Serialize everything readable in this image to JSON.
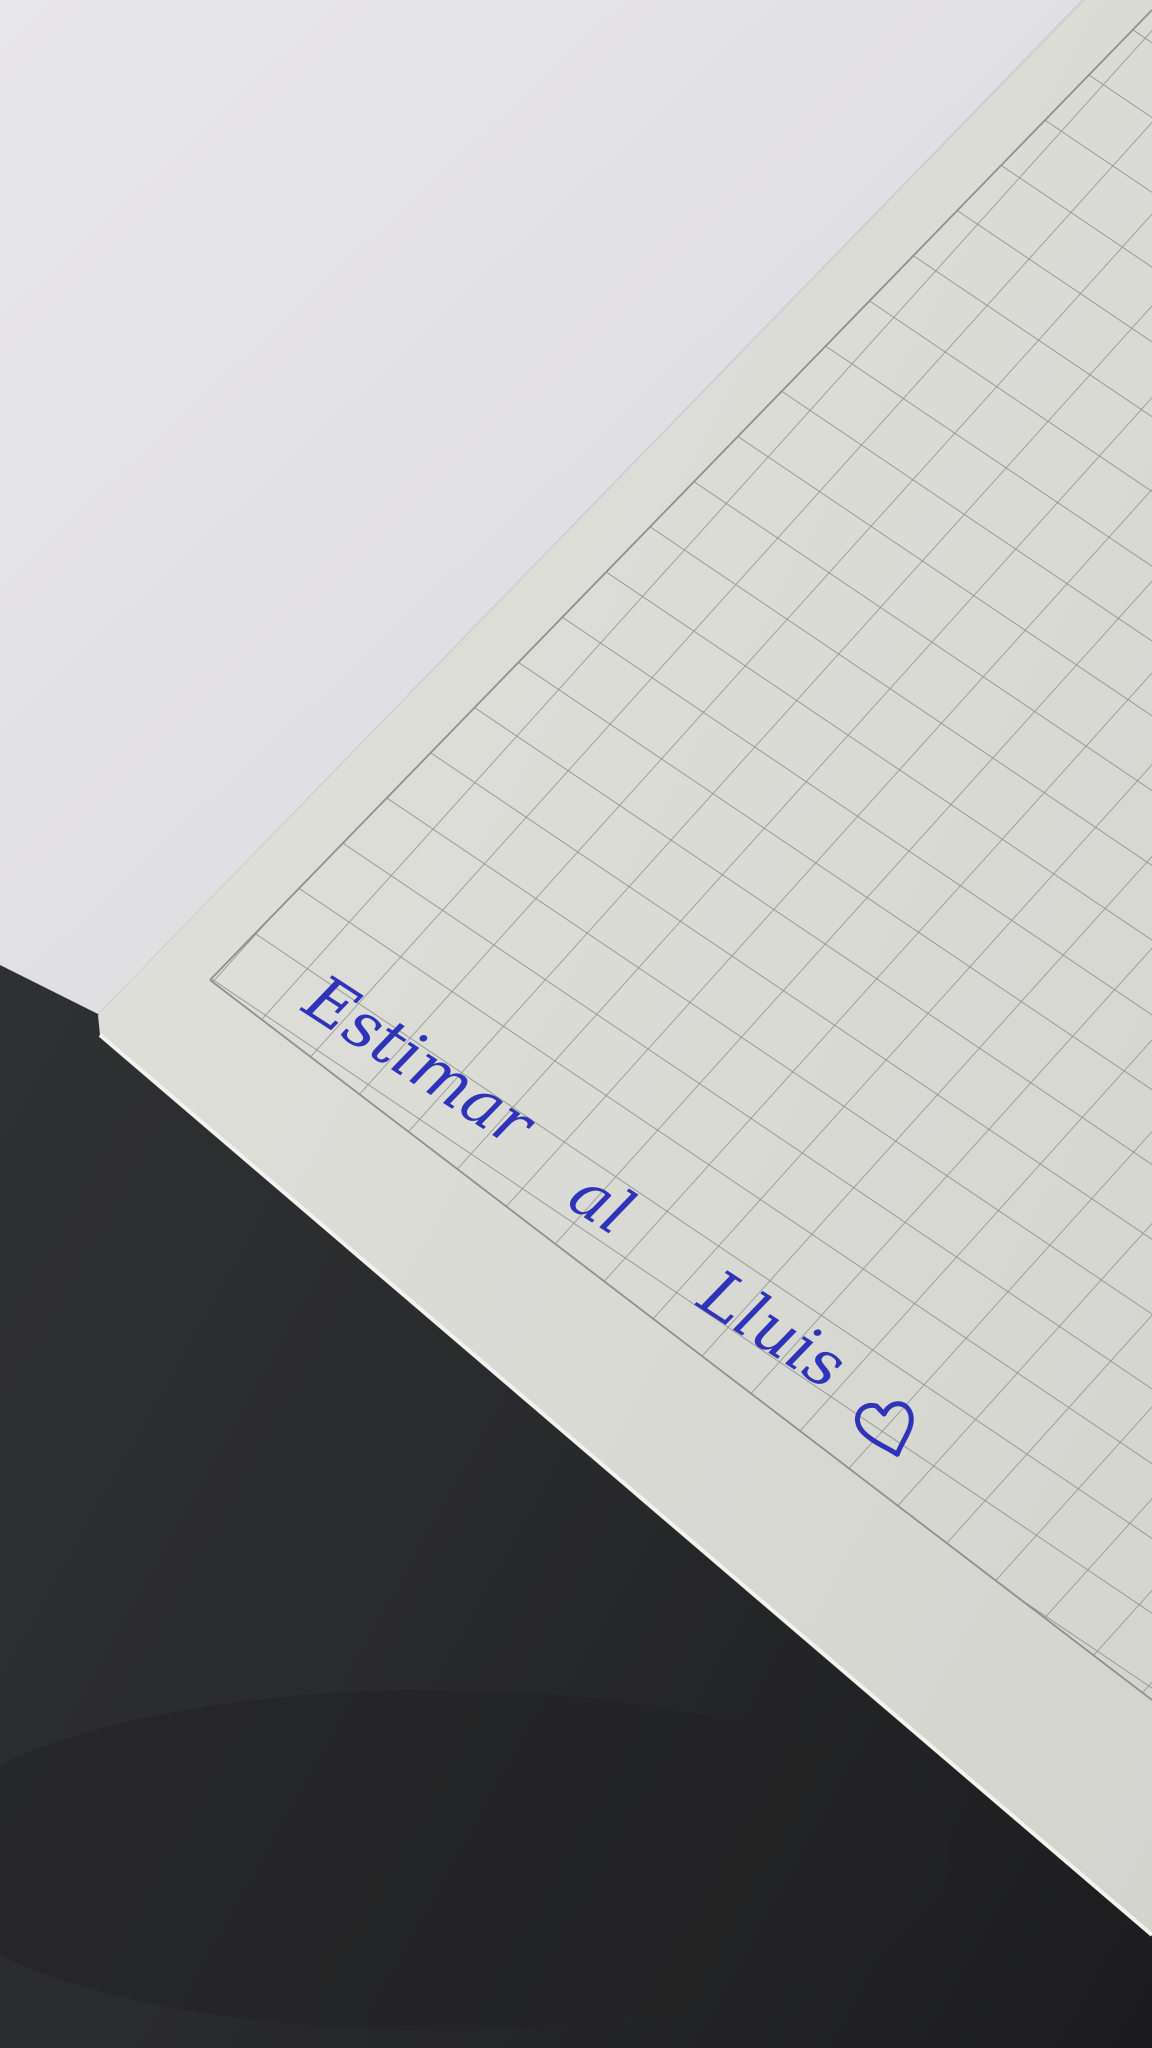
{
  "scene": {
    "description_colors": {
      "cover": "#e6e5e8",
      "paper": "#dcdcd6",
      "grid_line": "#8f8f8d",
      "desk": "#2a2b2d",
      "ink": "#2f33b8"
    }
  },
  "inscription": {
    "word1": "Estimar",
    "word2": "al",
    "word3": "Lluis",
    "heart_icon": "heart-outline-icon"
  }
}
